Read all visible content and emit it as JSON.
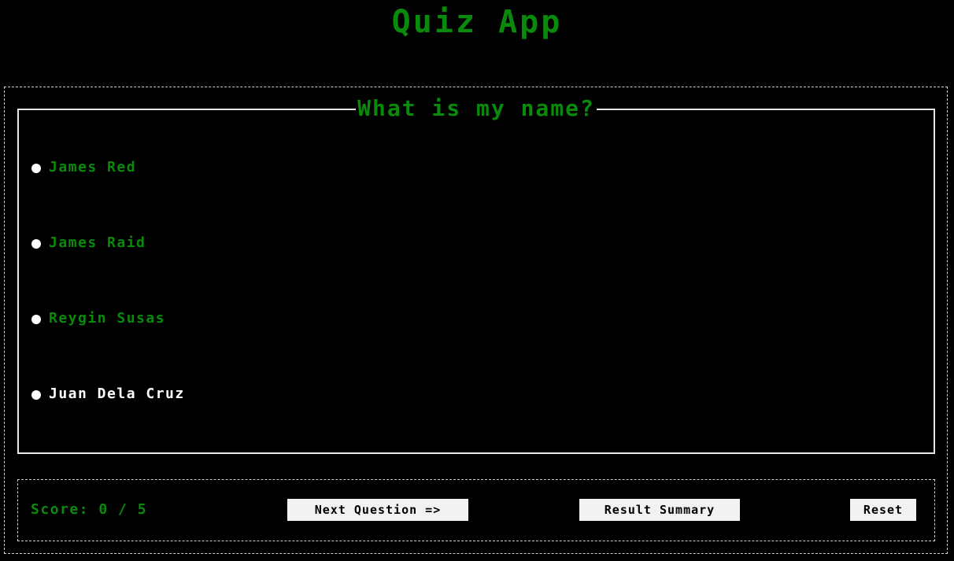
{
  "app": {
    "title": "Quiz App"
  },
  "question": {
    "text": "What is my name?",
    "options": [
      {
        "label": "James Red",
        "state": "normal"
      },
      {
        "label": "James Raid",
        "state": "normal"
      },
      {
        "label": "Reygin Susas",
        "state": "normal"
      },
      {
        "label": "Juan Dela Cruz",
        "state": "highlighted"
      }
    ]
  },
  "footer": {
    "score_text": "Score: 0 / 5",
    "next_label": "Next Question =>",
    "summary_label": "Result Summary",
    "reset_label": "Reset"
  },
  "colors": {
    "background": "#000000",
    "accent": "#0a8a0a",
    "highlight": "#ffffff",
    "button_bg": "#f2f2f2"
  }
}
